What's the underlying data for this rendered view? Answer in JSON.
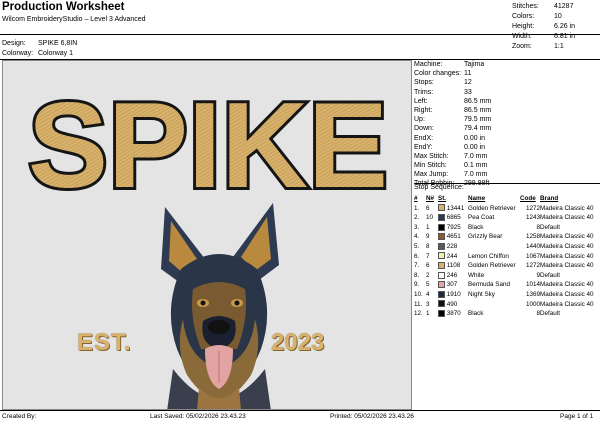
{
  "header": {
    "title": "Production Worksheet",
    "subtitle": "Wilcom EmbroideryStudio – Level 3 Advanced",
    "design_label": "Design:",
    "design_value": "SPIKE 6,8IN",
    "colorway_label": "Colorway:",
    "colorway_value": "Colorway 1"
  },
  "summary": [
    {
      "label": "Stitches:",
      "value": "41287"
    },
    {
      "label": "Colors:",
      "value": "10"
    },
    {
      "label": "Height:",
      "value": "6.26 in"
    },
    {
      "label": "Width:",
      "value": "6.81 in"
    },
    {
      "label": "Zoom:",
      "value": "1:1"
    }
  ],
  "design": {
    "word": "SPIKE",
    "est": "EST.",
    "year": "2023",
    "colors": {
      "gold": "#d8b26c",
      "outline": "#1a1a1a",
      "bg": "#e4e4e4"
    }
  },
  "machine_info": [
    {
      "label": "Machine:",
      "value": "Tajima"
    },
    {
      "label": "Color changes:",
      "value": "11"
    },
    {
      "label": "Stops:",
      "value": "12"
    },
    {
      "label": "Trims:",
      "value": "33"
    },
    {
      "label": "Left:",
      "value": "86.5 mm"
    },
    {
      "label": "Right:",
      "value": "86.5 mm"
    },
    {
      "label": "Up:",
      "value": "79.5 mm"
    },
    {
      "label": "Down:",
      "value": "79.4 mm"
    },
    {
      "label": "EndX:",
      "value": "0.00 in"
    },
    {
      "label": "EndY:",
      "value": "0.00 in"
    },
    {
      "label": "Max Stitch:",
      "value": "7.0 mm"
    },
    {
      "label": "Min Stitch:",
      "value": "0.1 mm"
    },
    {
      "label": "Max Jump:",
      "value": "7.0 mm"
    },
    {
      "label": "Total Bobbin:",
      "value": "299.98ft"
    }
  ],
  "stop_sequence": {
    "title": "Stop Sequence:",
    "headers": [
      "#",
      "N#",
      "St.",
      "Name",
      "Code",
      "Brand"
    ],
    "rows": [
      {
        "n": "1.",
        "needle": "6",
        "color": "#d8b26c",
        "st": "13441",
        "name": "Golden Retriever",
        "code": "1272",
        "brand": "Madeira Classic 40"
      },
      {
        "n": "2.",
        "needle": "10",
        "color": "#2a3a52",
        "st": "6865",
        "name": "Pea Coat",
        "code": "1243",
        "brand": "Madeira Classic 40"
      },
      {
        "n": "3.",
        "needle": "1",
        "color": "#000000",
        "st": "7925",
        "name": "Black",
        "code": "8",
        "brand": "Default"
      },
      {
        "n": "4.",
        "needle": "9",
        "color": "#8a5a2a",
        "st": "4651",
        "name": "Grizzly Bear",
        "code": "1258",
        "brand": "Madeira Classic 40"
      },
      {
        "n": "5.",
        "needle": "8",
        "color": "#5a5a5a",
        "st": "228",
        "name": "",
        "code": "1440",
        "brand": "Madeira Classic 40"
      },
      {
        "n": "6.",
        "needle": "7",
        "color": "#f3eeb0",
        "st": "244",
        "name": "Lemon Chiffon",
        "code": "1067",
        "brand": "Madeira Classic 40"
      },
      {
        "n": "7.",
        "needle": "6",
        "color": "#d8b26c",
        "st": "1108",
        "name": "Golden Retriever",
        "code": "1272",
        "brand": "Madeira Classic 40"
      },
      {
        "n": "8.",
        "needle": "2",
        "color": "#ffffff",
        "st": "246",
        "name": "White",
        "code": "9",
        "brand": "Default"
      },
      {
        "n": "9.",
        "needle": "5",
        "color": "#e6a3a3",
        "st": "307",
        "name": "Bermuda Sand",
        "code": "1014",
        "brand": "Madeira Classic 40"
      },
      {
        "n": "10.",
        "needle": "4",
        "color": "#1c2a40",
        "st": "1910",
        "name": "Night Sky",
        "code": "1369",
        "brand": "Madeira Classic 40"
      },
      {
        "n": "11.",
        "needle": "3",
        "color": "#111111",
        "st": "490",
        "name": "",
        "code": "1000",
        "brand": "Madeira Classic 40"
      },
      {
        "n": "12.",
        "needle": "1",
        "color": "#000000",
        "st": "3870",
        "name": "Black",
        "code": "8",
        "brand": "Default"
      }
    ]
  },
  "footer": {
    "created": "Created By:",
    "last_saved": "Last Saved: 05/02/2026 23.43.23",
    "printed": "Printed: 05/02/2026 23.43.26",
    "page": "Page 1 of 1"
  }
}
